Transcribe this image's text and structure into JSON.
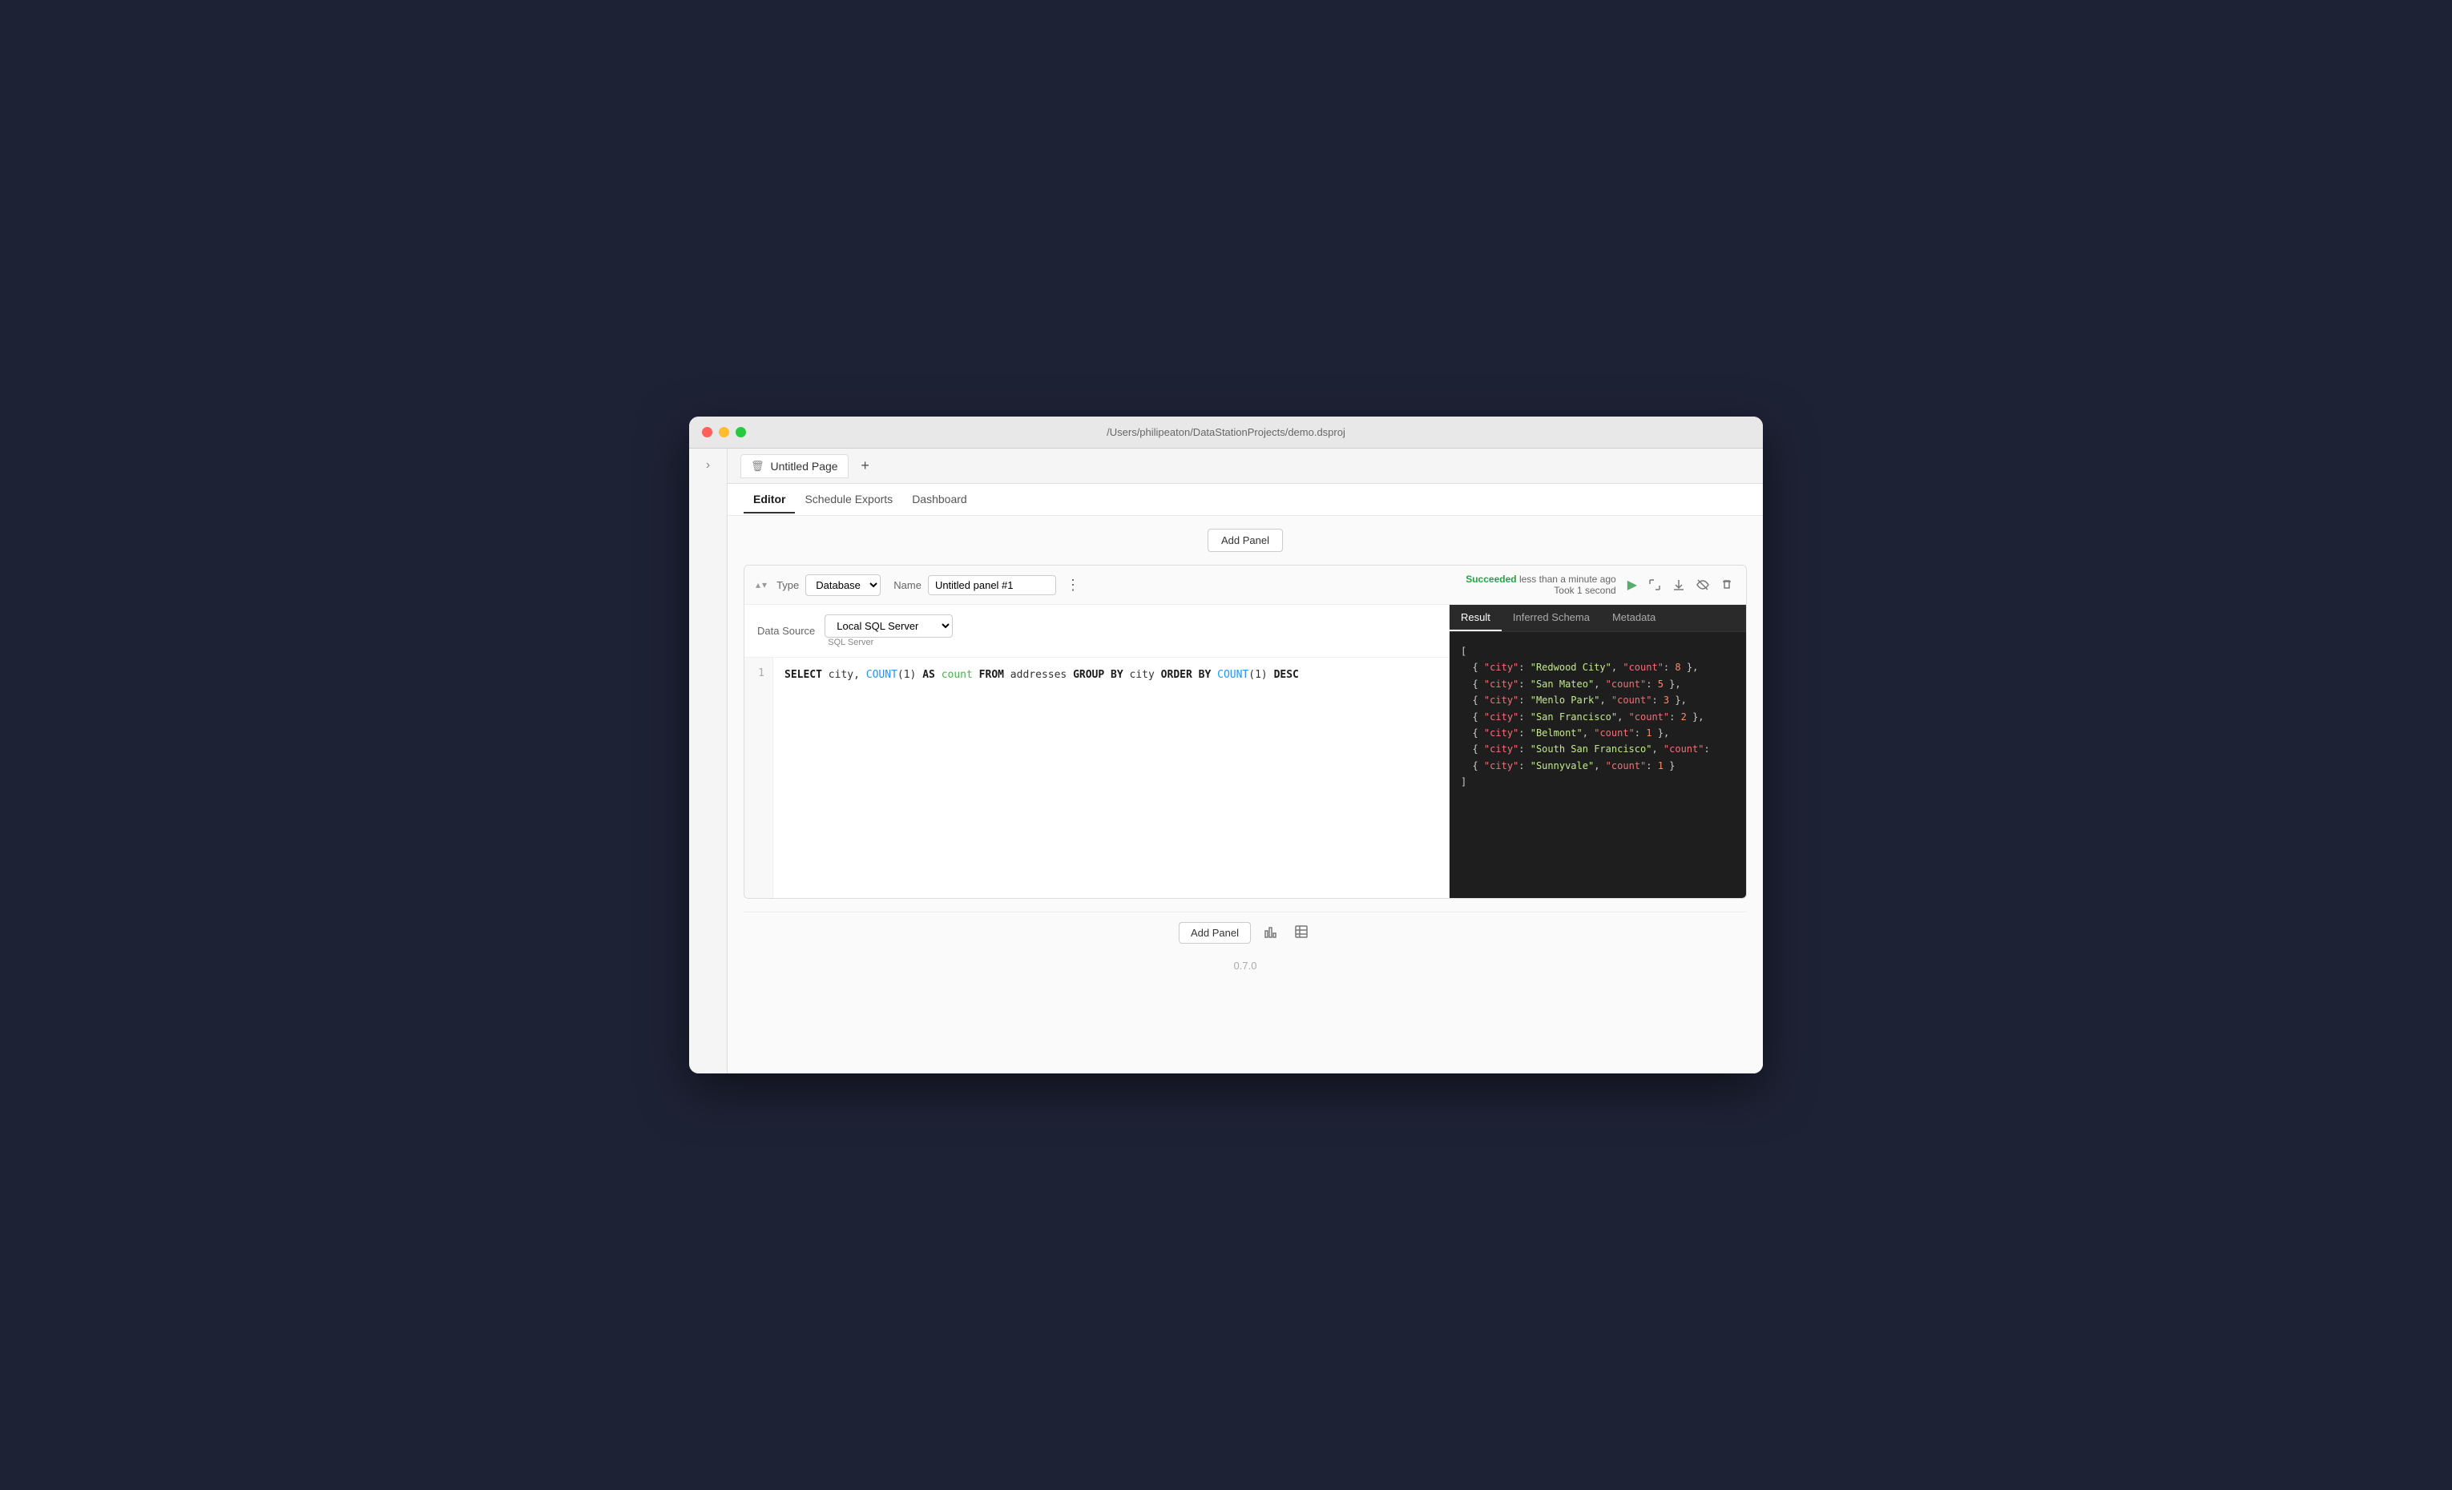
{
  "titlebar": {
    "title": "/Users/philipeaton/DataStationProjects/demo.dsproj"
  },
  "tabs": {
    "page_name": "Untitled Page",
    "add_label": "+"
  },
  "nav": {
    "items": [
      {
        "id": "editor",
        "label": "Editor",
        "active": true
      },
      {
        "id": "schedule",
        "label": "Schedule Exports",
        "active": false
      },
      {
        "id": "dashboard",
        "label": "Dashboard",
        "active": false
      }
    ]
  },
  "toolbar": {
    "add_panel_label": "Add Panel"
  },
  "panel": {
    "type_label": "Type",
    "type_value": "Database",
    "name_label": "Name",
    "name_value": "Untitled panel #1",
    "status_succeeded": "Succeeded",
    "status_time": "less than a minute ago",
    "status_took": "Took 1 second",
    "datasource_label": "Data Source",
    "datasource_value": "Local SQL Server",
    "datasource_subtitle": "SQL Server",
    "result_tabs": [
      "Result",
      "Inferred Schema",
      "Metadata"
    ],
    "active_result_tab": "Result",
    "sql_code": "SELECT city, COUNT(1) AS count FROM addresses GROUP BY city ORDER BY COUNT(1) DESC",
    "result_json": "[\n  { \"city\": \"Redwood City\", \"count\": 8 },\n  { \"city\": \"San Mateo\", \"count\": 5 },\n  { \"city\": \"Menlo Park\", \"count\": 3 },\n  { \"city\": \"San Francisco\", \"count\": 2 },\n  { \"city\": \"Belmont\", \"count\": 1 },\n  { \"city\": \"South San Francisco\", \"count\":\n  { \"city\": \"Sunnyvale\", \"count\": 1 }\n]"
  },
  "footer": {
    "add_panel_label": "Add Panel",
    "version": "0.7.0"
  }
}
